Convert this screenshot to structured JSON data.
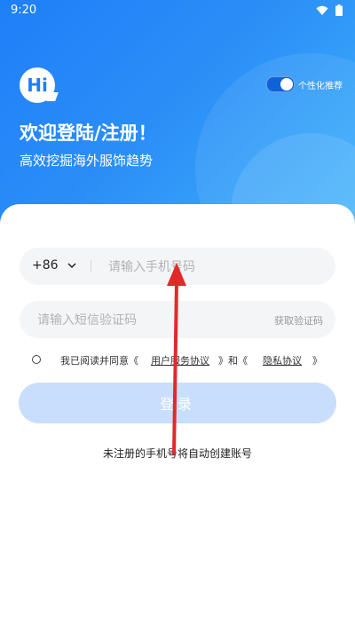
{
  "status_bar": {
    "time": "9:20",
    "wifi_icon": "wifi-icon",
    "battery_icon": "battery-icon"
  },
  "header": {
    "logo_text": "Hi",
    "toggle_label": "个性化推荐",
    "toggle_on": true,
    "title": "欢迎登陆/注册！",
    "subtitle": "高效挖掘海外服饰趋势"
  },
  "form": {
    "country_code": "+86",
    "phone_placeholder": "请输入手机号码",
    "code_placeholder": "请输入短信验证码",
    "get_code_label": "获取验证码",
    "agreement": {
      "prefix": "我已阅读并同意《",
      "link1": "用户服务协议",
      "middle": "》和《",
      "link2": "隐私协议",
      "suffix": "》"
    },
    "login_label": "登录",
    "note": "未注册的手机号将自动创建账号"
  },
  "colors": {
    "brand_blue": "#1e7ff8",
    "login_disabled": "#c9defc",
    "annotation_red": "#e02a2a"
  }
}
